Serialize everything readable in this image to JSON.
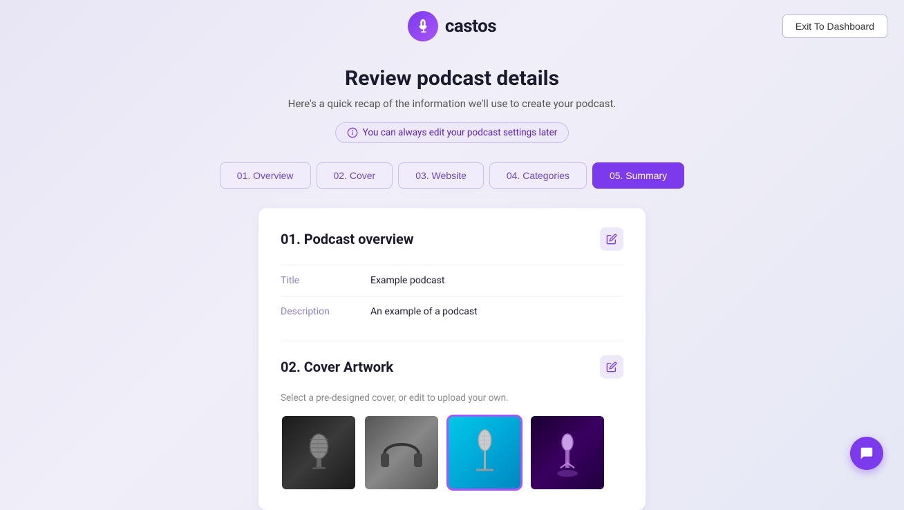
{
  "header": {
    "logo_text": "castos",
    "exit_button_label": "Exit To Dashboard"
  },
  "page": {
    "title": "Review podcast details",
    "subtitle": "Here's a quick recap of the information we'll use to create your podcast.",
    "info_badge": "You can always edit your podcast settings later"
  },
  "steps": [
    {
      "id": "overview",
      "label": "01. Overview",
      "active": false
    },
    {
      "id": "cover",
      "label": "02. Cover",
      "active": false
    },
    {
      "id": "website",
      "label": "03. Website",
      "active": false
    },
    {
      "id": "categories",
      "label": "04. Categories",
      "active": false
    },
    {
      "id": "summary",
      "label": "05. Summary",
      "active": true
    }
  ],
  "sections": {
    "overview": {
      "title": "01. Podcast overview",
      "fields": [
        {
          "label": "Title",
          "value": "Example podcast"
        },
        {
          "label": "Description",
          "value": "An example of a podcast"
        }
      ]
    },
    "cover": {
      "title": "02. Cover Artwork",
      "subtitle": "Select a pre-designed cover, or edit to upload your own.",
      "selected_index": 2
    }
  }
}
